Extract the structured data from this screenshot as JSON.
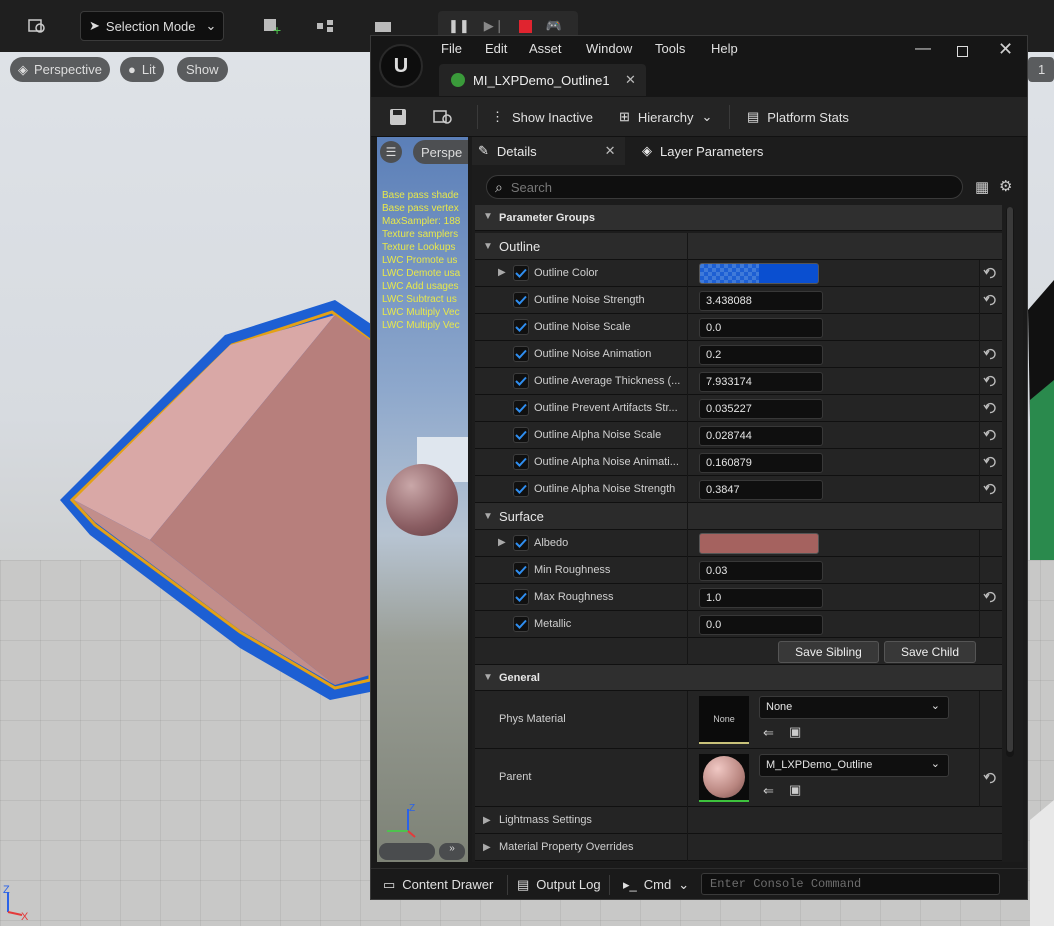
{
  "main_toolbar": {
    "selection_mode": "Selection Mode"
  },
  "viewport": {
    "perspective": "Perspective",
    "lit": "Lit",
    "show": "Show"
  },
  "editor": {
    "menu": [
      "File",
      "Edit",
      "Asset",
      "Window",
      "Tools",
      "Help"
    ],
    "tab_title": "MI_LXPDemo_Outline1",
    "toolbar": {
      "show_inactive": "Show Inactive",
      "hierarchy": "Hierarchy",
      "platform_stats": "Platform Stats"
    },
    "preview": {
      "perspective": "Perspe",
      "stats": [
        "Base pass shade",
        "Base pass vertex",
        "MaxSampler: 188",
        "Texture samplers",
        "Texture Lookups",
        "LWC Promote us",
        "LWC Demote usa",
        "LWC Add usages",
        "LWC Subtract us",
        "LWC Multiply Vec",
        "LWC Multiply Vec"
      ]
    },
    "panel_tabs": {
      "details": "Details",
      "layer_parameters": "Layer Parameters"
    },
    "search_placeholder": "Search",
    "parameter_groups": "Parameter Groups",
    "outline": {
      "title": "Outline",
      "color_label": "Outline Color",
      "params": [
        {
          "label": "Outline Noise Strength",
          "value": "3.438088",
          "reset": true
        },
        {
          "label": "Outline Noise Scale",
          "value": "0.0",
          "reset": false
        },
        {
          "label": "Outline Noise Animation",
          "value": "0.2",
          "reset": true
        },
        {
          "label": "Outline Average Thickness (...",
          "value": "7.933174",
          "reset": true
        },
        {
          "label": "Outline Prevent Artifacts Str...",
          "value": "0.035227",
          "reset": true
        },
        {
          "label": "Outline Alpha Noise Scale",
          "value": "0.028744",
          "reset": true
        },
        {
          "label": "Outline Alpha Noise Animati...",
          "value": "0.160879",
          "reset": true
        },
        {
          "label": "Outline Alpha Noise Strength",
          "value": "0.3847",
          "reset": true
        }
      ]
    },
    "surface": {
      "title": "Surface",
      "albedo": "Albedo",
      "params": [
        {
          "label": "Min Roughness",
          "value": "0.03",
          "reset": false
        },
        {
          "label": "Max Roughness",
          "value": "1.0",
          "reset": true
        },
        {
          "label": "Metallic",
          "value": "0.0",
          "reset": false
        }
      ]
    },
    "buttons": {
      "save_sibling": "Save Sibling",
      "save_child": "Save Child"
    },
    "general": {
      "title": "General",
      "phys_material": "Phys Material",
      "phys_value": "None",
      "phys_thumb": "None",
      "parent": "Parent",
      "parent_value": "M_LXPDemo_Outline"
    },
    "lightmass": "Lightmass Settings",
    "overrides": "Material Property Overrides",
    "status": {
      "content_drawer": "Content Drawer",
      "output_log": "Output Log",
      "cmd": "Cmd",
      "console_placeholder": "Enter Console Command"
    }
  },
  "colors": {
    "outline_color": "#0a4fd0",
    "albedo": "#a5625f",
    "accent": "#1f6fd1"
  }
}
